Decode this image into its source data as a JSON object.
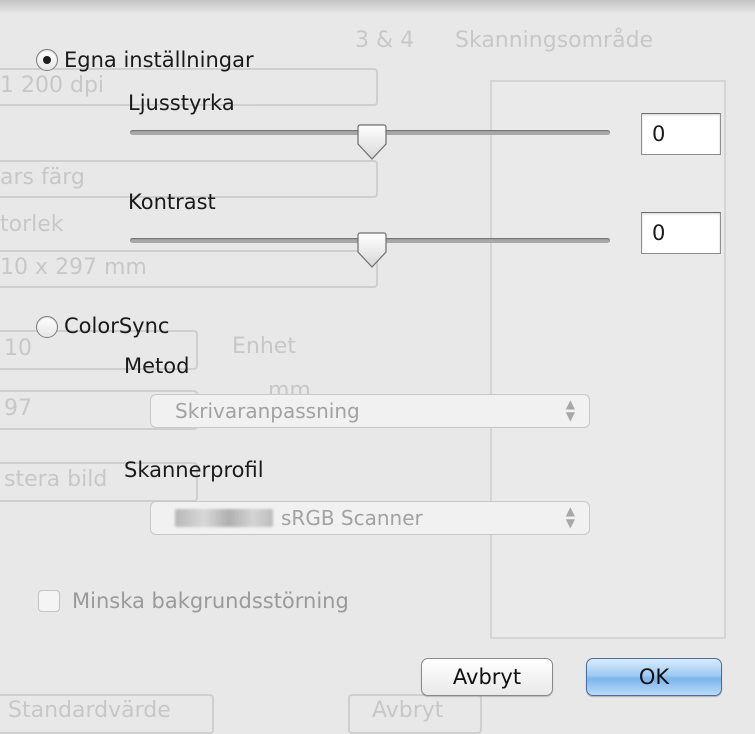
{
  "background_window": {
    "texts": [
      "3 & 4",
      "Skanningsområde",
      "1 200 dpi",
      "ars färg",
      "torlek",
      "10 x 297 mm",
      "10",
      "Enhet",
      "mm",
      "97",
      "stera bild",
      "Standardvärde",
      "Avbryt"
    ]
  },
  "settings": {
    "custom": {
      "label": "Egna inställningar",
      "selected": true
    },
    "brightness": {
      "label": "Ljusstyrka",
      "value": "0",
      "level": 0.5
    },
    "contrast": {
      "label": "Kontrast",
      "value": "0",
      "level": 0.5
    },
    "colorsync": {
      "label": "ColorSync",
      "selected": false
    },
    "method": {
      "label": "Metod",
      "selected": "Skrivaranpassning"
    },
    "scanner_profile": {
      "label": "Skannerprofil",
      "selected": "sRGB Scanner"
    },
    "reduce_noise": {
      "label": "Minska bakgrundsstörning",
      "checked": false
    }
  },
  "buttons": {
    "cancel": "Avbryt",
    "ok": "OK"
  },
  "colors": {
    "ok_button": "#8fc1f0",
    "disabled_text": "#9a9a9a"
  }
}
